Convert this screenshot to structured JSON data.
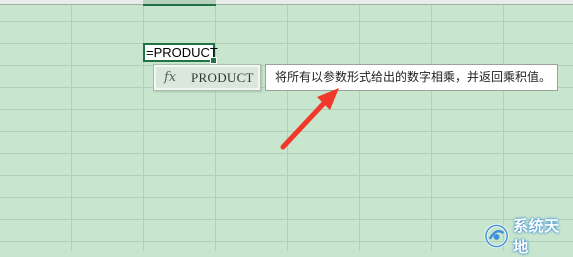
{
  "formula_cell": {
    "text": "=PRODUCT"
  },
  "autocomplete": {
    "icon": "fx-icon",
    "icon_glyph": "fx",
    "selected_function": "PRODUCT"
  },
  "tooltip": {
    "description": "将所有以参数形式给出的数字相乘，并返回乘积值。"
  },
  "annotation": {
    "arrow_color": "#f0392a"
  },
  "watermark": {
    "text": "系统天地"
  },
  "colors": {
    "sheet_background": "#c8e6cd",
    "gridline": "#b2d0b8",
    "active_cell_border": "#217346"
  }
}
